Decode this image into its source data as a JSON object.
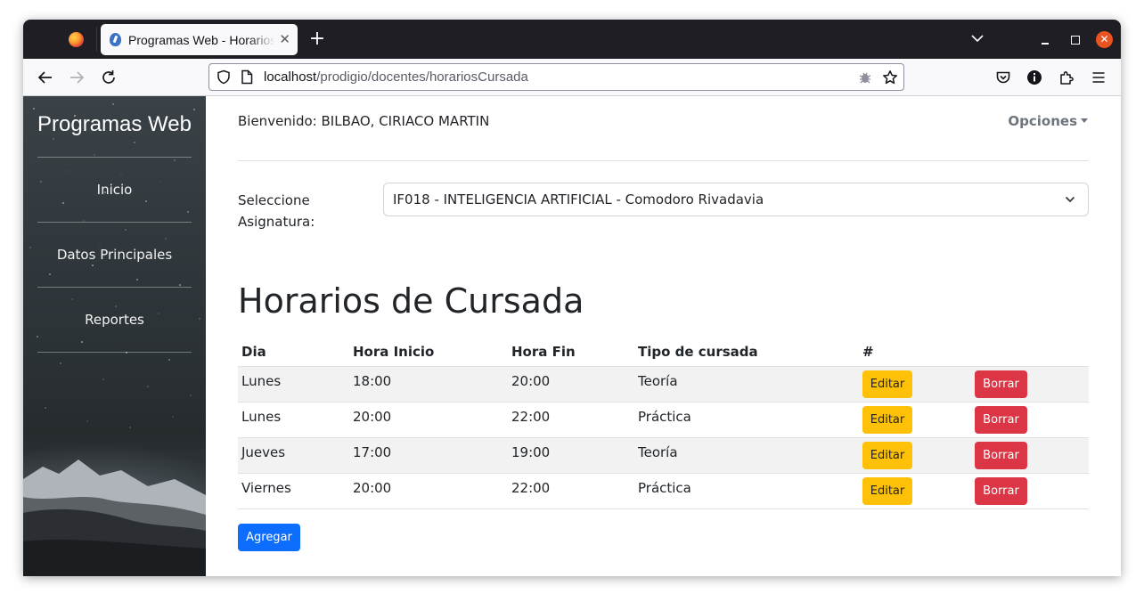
{
  "browser": {
    "tab_title": "Programas Web - Horarios de Cursada",
    "url_host": "localhost",
    "url_path": "/prodigio/docentes/horariosCursada"
  },
  "sidebar": {
    "brand": "Programas Web",
    "items": [
      {
        "label": "Inicio"
      },
      {
        "label": "Datos Principales"
      },
      {
        "label": "Reportes"
      }
    ]
  },
  "header": {
    "welcome": "Bienvenido: BILBAO, CIRIACO MARTIN",
    "options_label": "Opciones"
  },
  "subject_select": {
    "label": "Seleccione Asignatura:",
    "value": "IF018 - INTELIGENCIA ARTIFICIAL - Comodoro Rivadavia"
  },
  "page_title": "Horarios de Cursada",
  "table": {
    "headers": {
      "dia": "Dia",
      "inicio": "Hora Inicio",
      "fin": "Hora Fin",
      "tipo": "Tipo de cursada",
      "hash": "#"
    },
    "edit_label": "Editar",
    "delete_label": "Borrar",
    "rows": [
      {
        "dia": "Lunes",
        "inicio": "18:00",
        "fin": "20:00",
        "tipo": "Teoría"
      },
      {
        "dia": "Lunes",
        "inicio": "20:00",
        "fin": "22:00",
        "tipo": "Práctica"
      },
      {
        "dia": "Jueves",
        "inicio": "17:00",
        "fin": "19:00",
        "tipo": "Teoría"
      },
      {
        "dia": "Viernes",
        "inicio": "20:00",
        "fin": "22:00",
        "tipo": "Práctica"
      }
    ]
  },
  "add_button": "Agregar",
  "colors": {
    "primary": "#0d6efd",
    "warning": "#ffc107",
    "danger": "#dc3545",
    "firefox_close": "#e95420"
  }
}
